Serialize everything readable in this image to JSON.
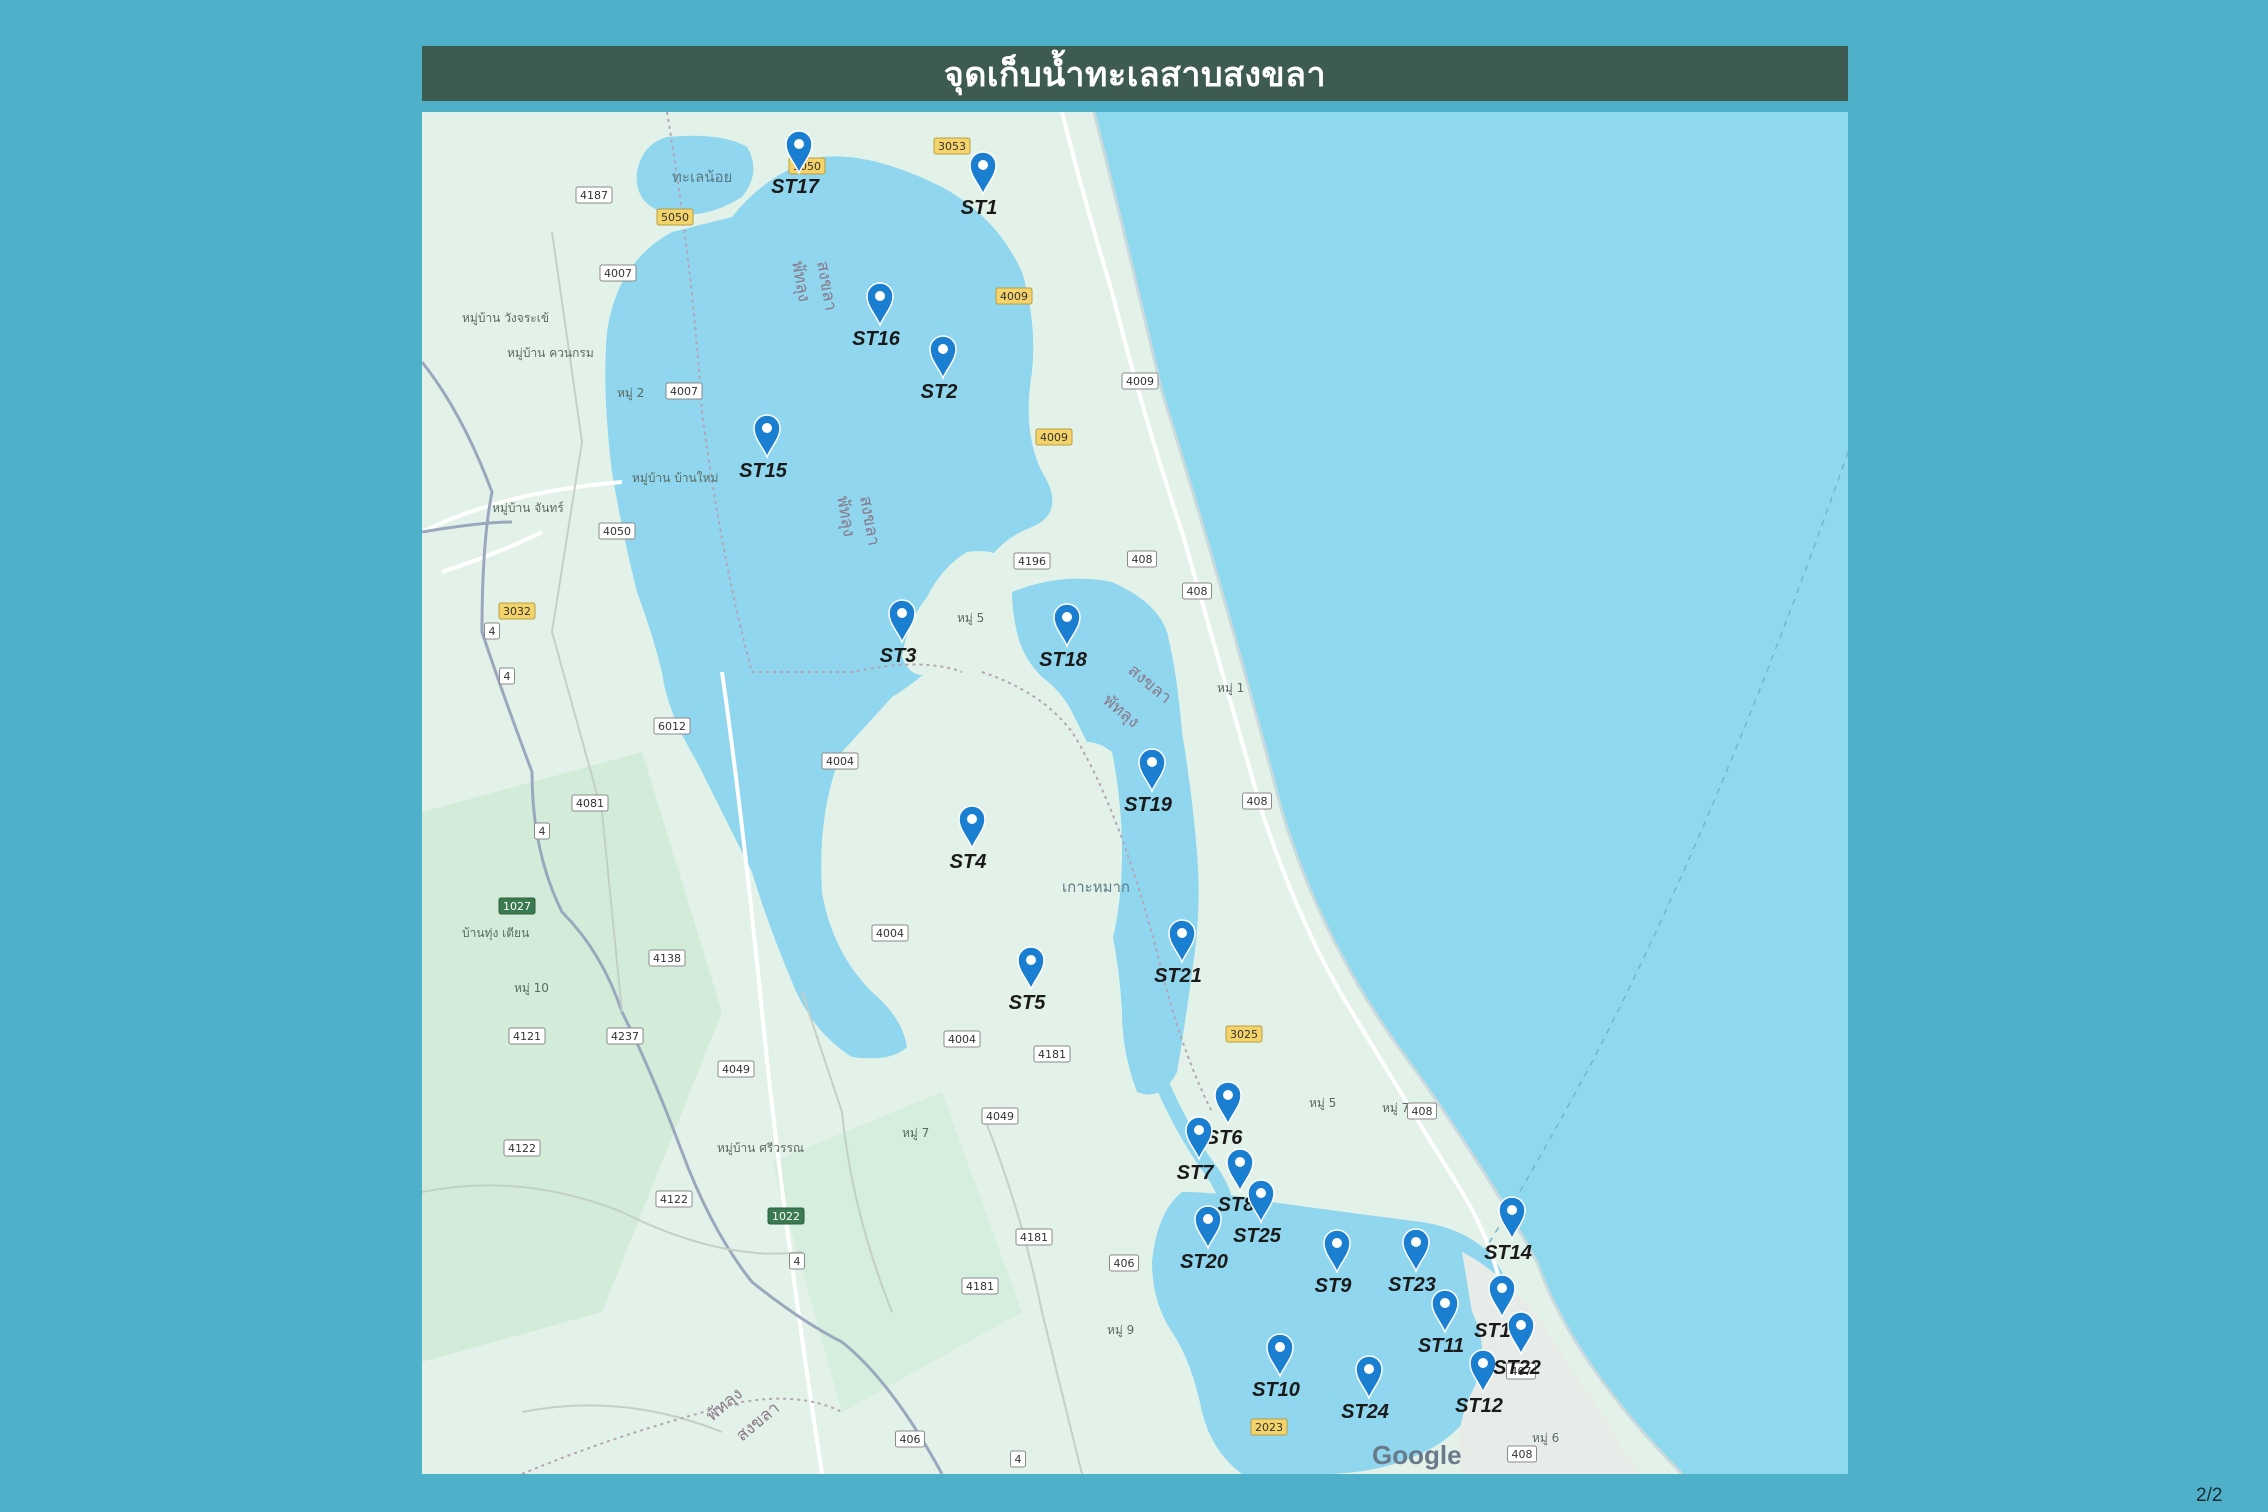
{
  "title": "จุดเก็บน้ำทะเลสาบสงขลา",
  "page_indicator": "2/2",
  "colors": {
    "background": "#4eb1c9",
    "title_bar": "#3e5b51",
    "land": "#e3f2e8",
    "lake": "#8fd6ee",
    "sea": "#8fd9ef",
    "marker": "#1a7ed1"
  },
  "map": {
    "attribution": "Google",
    "lake_label": "ทะเลน้อย",
    "district_label": "เกาะหมาก",
    "border_labels": [
      "สงขลา",
      "พัทลุง"
    ],
    "village_labels": [
      "หมู่บ้าน วังจระเข้",
      "หมู่บ้าน ควนกรม",
      "หมู่ 2",
      "หมู่บ้าน บ้านใหม่",
      "หมู่บ้าน จันทร์",
      "หมู่ 5",
      "หมู่ 1",
      "บ้านทุ่ง เตียน",
      "หมู่ 10",
      "หมู่ 7",
      "หมู่บ้าน ศรีวรรณ",
      "หมู่ 9",
      "หมู่ 5",
      "หมู่ 7",
      "หมู่ 6"
    ],
    "road_numbers": [
      "4187",
      "5050",
      "5050",
      "3053",
      "4007",
      "4009",
      "4009",
      "4007",
      "4009",
      "408",
      "4196",
      "408",
      "3032",
      "4050",
      "4",
      "4",
      "6012",
      "4004",
      "4081",
      "408",
      "4",
      "1027",
      "4004",
      "4138",
      "4121",
      "4237",
      "4004",
      "4049",
      "4181",
      "3025",
      "4049",
      "4122",
      "4122",
      "1022",
      "4181",
      "406",
      "4181",
      "408",
      "4",
      "407",
      "408",
      "2023",
      "406",
      "4"
    ]
  },
  "stations": [
    {
      "id": "ST1"
    },
    {
      "id": "ST2"
    },
    {
      "id": "ST3"
    },
    {
      "id": "ST4"
    },
    {
      "id": "ST5"
    },
    {
      "id": "ST6"
    },
    {
      "id": "ST7"
    },
    {
      "id": "ST8"
    },
    {
      "id": "ST9"
    },
    {
      "id": "ST10"
    },
    {
      "id": "ST11"
    },
    {
      "id": "ST12"
    },
    {
      "id": "ST13"
    },
    {
      "id": "ST14"
    },
    {
      "id": "ST15"
    },
    {
      "id": "ST16"
    },
    {
      "id": "ST17"
    },
    {
      "id": "ST18"
    },
    {
      "id": "ST19"
    },
    {
      "id": "ST20"
    },
    {
      "id": "ST21"
    },
    {
      "id": "ST22"
    },
    {
      "id": "ST23"
    },
    {
      "id": "ST24"
    },
    {
      "id": "ST25"
    }
  ]
}
